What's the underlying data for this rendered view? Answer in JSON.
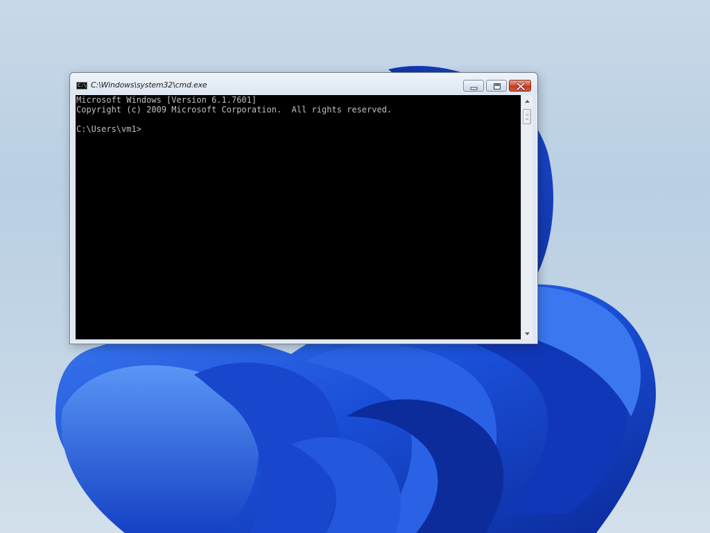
{
  "desktop": {
    "wallpaper_icon": "windows-bloom-wallpaper"
  },
  "window": {
    "title": "C:\\Windows\\system32\\cmd.exe",
    "icon": "cmd-icon",
    "icon_glyph": "C:\\",
    "controls": {
      "minimize_icon": "minimize-icon",
      "maximize_icon": "maximize-icon",
      "close_icon": "close-icon"
    }
  },
  "console": {
    "lines": [
      "Microsoft Windows [Version 6.1.7601]",
      "Copyright (c) 2009 Microsoft Corporation.  All rights reserved.",
      "",
      "C:\\Users\\vm1>"
    ]
  },
  "colors": {
    "console_bg": "#000000",
    "console_fg": "#c0c0c0",
    "close_button": "#c23a22",
    "wallpaper_blue": "#1f52d6"
  }
}
